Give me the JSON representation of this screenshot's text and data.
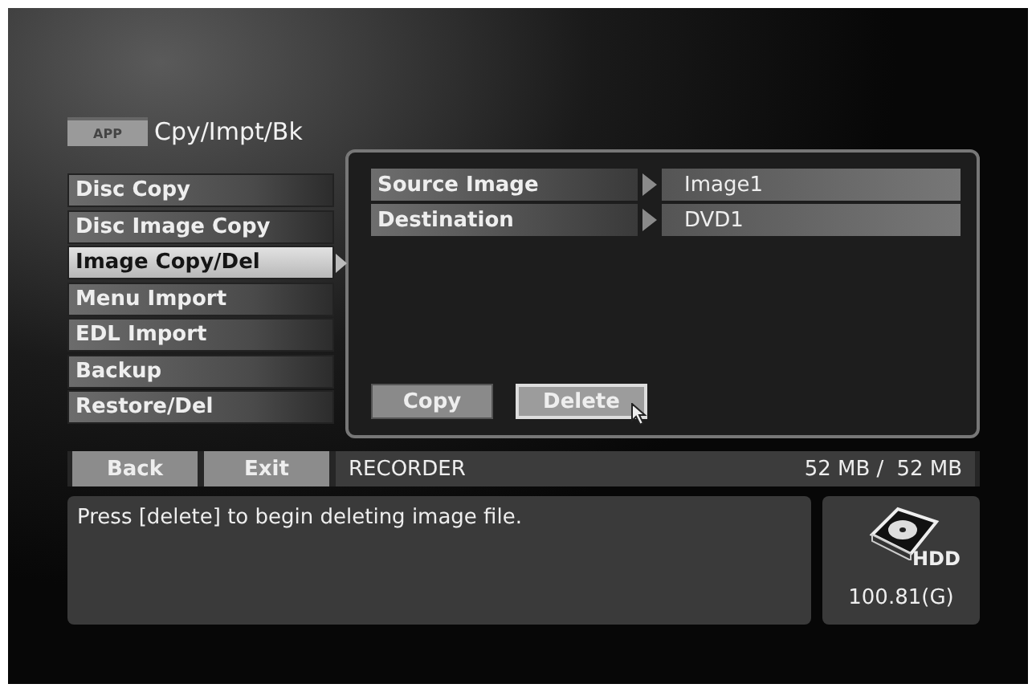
{
  "header": {
    "badge": "APP",
    "title": "Cpy/Impt/Bk"
  },
  "menu": [
    {
      "label": "Disc Copy",
      "selected": false
    },
    {
      "label": "Disc Image Copy",
      "selected": false
    },
    {
      "label": "Image Copy/Del",
      "selected": true
    },
    {
      "label": "Menu Import",
      "selected": false
    },
    {
      "label": "EDL Import",
      "selected": false
    },
    {
      "label": "Backup",
      "selected": false
    },
    {
      "label": "Restore/Del",
      "selected": false
    }
  ],
  "fields": [
    {
      "label": "Source Image",
      "value": "Image1"
    },
    {
      "label": "Destination",
      "value": "DVD1"
    }
  ],
  "actions": [
    {
      "label": "Copy",
      "selected": false
    },
    {
      "label": "Delete",
      "selected": true
    }
  ],
  "nav_buttons": [
    "Back",
    "Exit"
  ],
  "status": {
    "device": "RECORDER",
    "used": "52 MB /",
    "total": "52 MB"
  },
  "message": "Press [delete] to begin deleting image file.",
  "drive": {
    "label": "HDD",
    "capacity": "100.81(G)"
  }
}
